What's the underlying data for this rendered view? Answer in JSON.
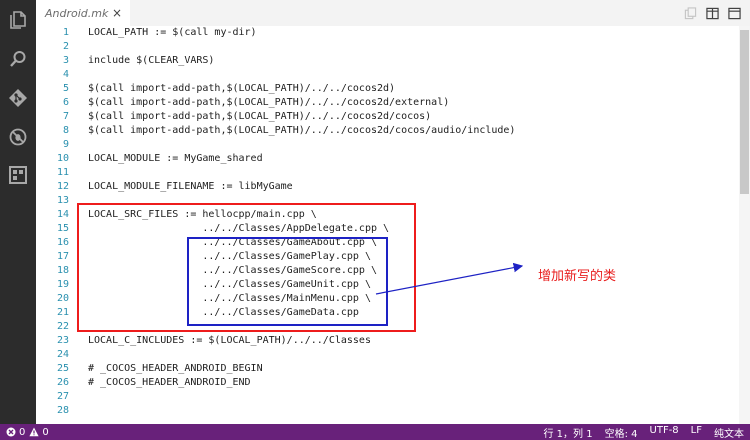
{
  "tab": {
    "label": "Android.mk",
    "close_glyph": "×"
  },
  "tab_actions": [
    {
      "name": "open-changes-icon"
    },
    {
      "name": "split-editor-icon"
    },
    {
      "name": "more-icon"
    }
  ],
  "activity_icons": [
    "files-icon",
    "search-icon",
    "git-icon",
    "debug-icon",
    "extensions-icon"
  ],
  "lines": [
    {
      "num": "1",
      "text": "LOCAL_PATH := $(call my-dir)"
    },
    {
      "num": "2",
      "text": ""
    },
    {
      "num": "3",
      "text": "include $(CLEAR_VARS)"
    },
    {
      "num": "4",
      "text": ""
    },
    {
      "num": "5",
      "text": "$(call import-add-path,$(LOCAL_PATH)/../../cocos2d)"
    },
    {
      "num": "6",
      "text": "$(call import-add-path,$(LOCAL_PATH)/../../cocos2d/external)"
    },
    {
      "num": "7",
      "text": "$(call import-add-path,$(LOCAL_PATH)/../../cocos2d/cocos)"
    },
    {
      "num": "8",
      "text": "$(call import-add-path,$(LOCAL_PATH)/../../cocos2d/cocos/audio/include)"
    },
    {
      "num": "9",
      "text": ""
    },
    {
      "num": "10",
      "text": "LOCAL_MODULE := MyGame_shared"
    },
    {
      "num": "11",
      "text": ""
    },
    {
      "num": "12",
      "text": "LOCAL_MODULE_FILENAME := libMyGame"
    },
    {
      "num": "13",
      "text": ""
    },
    {
      "num": "14",
      "text": "LOCAL_SRC_FILES := hellocpp/main.cpp \\"
    },
    {
      "num": "15",
      "text": "                   ../../Classes/AppDelegate.cpp \\"
    },
    {
      "num": "16",
      "text": "                   ../../Classes/GameAbout.cpp \\"
    },
    {
      "num": "17",
      "text": "                   ../../Classes/GamePlay.cpp \\"
    },
    {
      "num": "18",
      "text": "                   ../../Classes/GameScore.cpp \\"
    },
    {
      "num": "19",
      "text": "                   ../../Classes/GameUnit.cpp \\"
    },
    {
      "num": "20",
      "text": "                   ../../Classes/MainMenu.cpp \\"
    },
    {
      "num": "21",
      "text": "                   ../../Classes/GameData.cpp"
    },
    {
      "num": "22",
      "text": ""
    },
    {
      "num": "23",
      "text": "LOCAL_C_INCLUDES := $(LOCAL_PATH)/../../Classes"
    },
    {
      "num": "24",
      "text": ""
    },
    {
      "num": "25",
      "text": "# _COCOS_HEADER_ANDROID_BEGIN"
    },
    {
      "num": "26",
      "text": "# _COCOS_HEADER_ANDROID_END"
    },
    {
      "num": "27",
      "text": ""
    },
    {
      "num": "28",
      "text": ""
    }
  ],
  "annotation": {
    "text": "增加新写的类",
    "color": "#e81e1e"
  },
  "status": {
    "errors": "0",
    "warnings": "0",
    "position": "行 1，列 1",
    "spaces": "空格: 4",
    "encoding": "UTF-8",
    "eol": "LF",
    "language": "纯文本"
  },
  "colors": {
    "activity_bar": "#2c2c2c",
    "status_bar": "#68217a",
    "line_number": "#2b91af",
    "highlight_red": "#ee1c1c",
    "highlight_blue": "#1d22c4"
  }
}
